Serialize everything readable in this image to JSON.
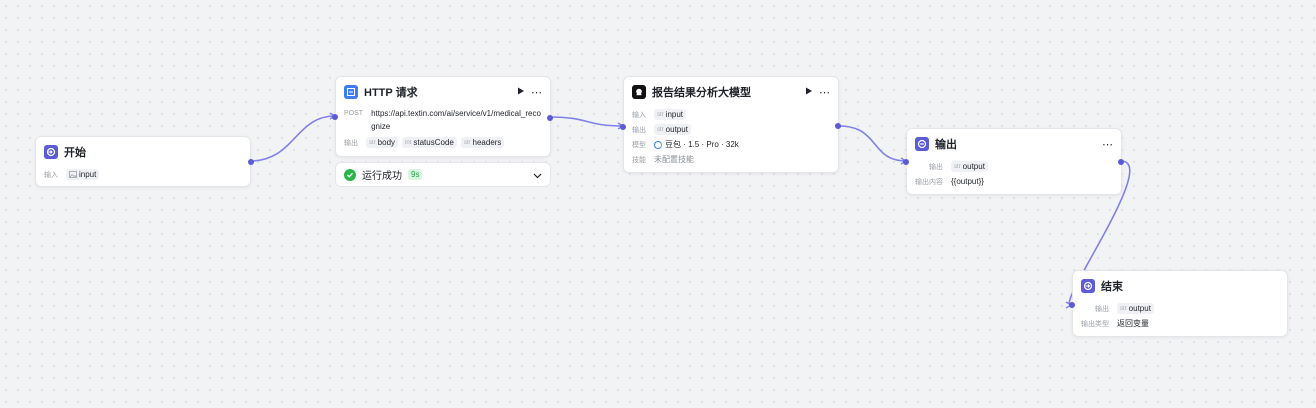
{
  "colors": {
    "accent": "#5b5bd6",
    "edge": "#8080ea",
    "success": "#2bb44a"
  },
  "nodes": {
    "start": {
      "title": "开始",
      "icon": "enter-icon",
      "input_label": "输入",
      "input_var": "input"
    },
    "http": {
      "title": "HTTP 请求",
      "icon": "http-icon",
      "method": "POST",
      "url": "https://api.textin.com/ai/service/v1/medical_recognize",
      "output_label": "输出",
      "outputs": [
        {
          "type": "str",
          "name": "body"
        },
        {
          "type": "int",
          "name": "statusCode"
        },
        {
          "type": "str",
          "name": "headers"
        }
      ],
      "status": {
        "text": "运行成功",
        "time": "9s"
      }
    },
    "llm": {
      "title": "报告结果分析大模型",
      "icon": "model-icon",
      "input_label": "输入",
      "input_tag": {
        "type": "str",
        "name": "input"
      },
      "output_label": "输出",
      "output_tag": {
        "type": "str",
        "name": "output"
      },
      "model_label": "模型",
      "model_value": "豆包 · 1.5 · Pro · 32k",
      "skill_label": "技能",
      "skill_value": "未配置技能"
    },
    "output": {
      "title": "输出",
      "icon": "output-icon",
      "output_label": "输出",
      "output_tag": {
        "type": "str",
        "name": "output"
      },
      "content_label": "输出内容",
      "content_value": "{{output}}"
    },
    "end": {
      "title": "结束",
      "icon": "end-icon",
      "output_label": "输出",
      "output_tag": {
        "type": "str",
        "name": "output"
      },
      "type_label": "输出类型",
      "type_value": "返回变量"
    }
  }
}
